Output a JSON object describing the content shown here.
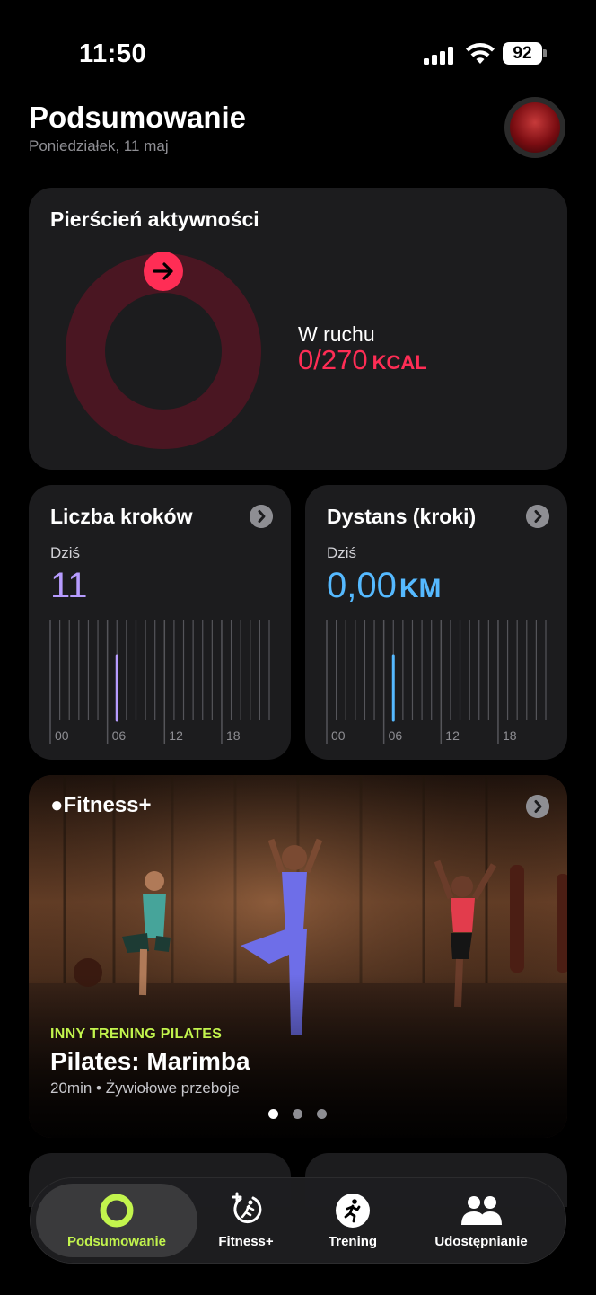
{
  "status_bar": {
    "time": "11:50",
    "battery": "92"
  },
  "header": {
    "title": "Podsumowanie",
    "date": "Poniedziałek, 11 maj"
  },
  "activity": {
    "title": "Pierścień aktywności",
    "move_label": "W ruchu",
    "move_value": "0/270",
    "move_unit": "KCAL",
    "move_progress": 0,
    "color": "#ff2d55"
  },
  "steps": {
    "title": "Liczba kroków",
    "today_label": "Dziś",
    "value": "11",
    "ticks": [
      "00",
      "06",
      "12",
      "18"
    ],
    "active_hour": 7,
    "color": "#b79cff"
  },
  "distance": {
    "title": "Dystans (kroki)",
    "today_label": "Dziś",
    "value": "0,00",
    "unit": "KM",
    "ticks": [
      "00",
      "06",
      "12",
      "18"
    ],
    "active_hour": 7,
    "color": "#55b9ff"
  },
  "fitness": {
    "logo": "Fitness+",
    "kicker": "INNY TRENING PILATES",
    "title": "Pilates: Marimba",
    "meta": "20min • Żywiołowe przeboje",
    "page_count": 3,
    "active_page": 0
  },
  "tabs": [
    {
      "label": "Podsumowanie",
      "icon": "activity-ring-icon",
      "active": true
    },
    {
      "label": "Fitness+",
      "icon": "fitness-plus-icon",
      "active": false
    },
    {
      "label": "Trening",
      "icon": "running-figure-icon",
      "active": false
    },
    {
      "label": "Udostępnianie",
      "icon": "people-icon",
      "active": false
    }
  ]
}
